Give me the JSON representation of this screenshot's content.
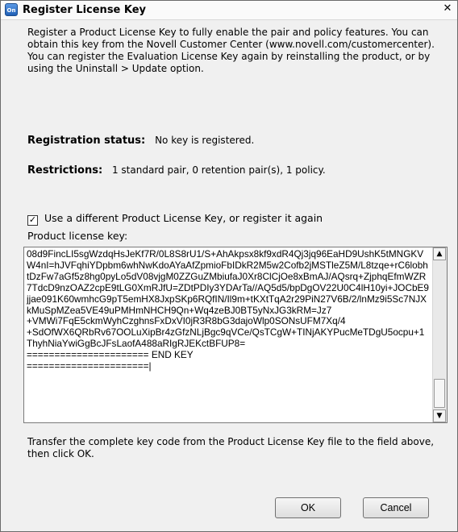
{
  "window": {
    "title": "Register License Key",
    "app_icon": "novell-icon",
    "close_glyph": "✕"
  },
  "intro_text": "Register a Product License Key to fully enable the pair and policy features. You can obtain this key from the Novell Customer Center (www.novell.com/customercenter). You can register the Evaluation License Key again by reinstalling the product, or by using the Uninstall > Update option.",
  "registration": {
    "label": "Registration status:",
    "value": "No key is registered."
  },
  "restrictions": {
    "label": "Restrictions:",
    "value": "1 standard pair, 0 retention pair(s), 1 policy."
  },
  "checkbox": {
    "label": "Use a different Product License Key, or register it again",
    "checked": true
  },
  "key_field": {
    "label": "Product license key:",
    "value": "08d9FincLI5sgWzdqHsJeKf7R/0L8S8rU1/S+AhAkpsx8kf9xdR4Qj3jq96EaHD9UshK5tMNGKVW4nI=hJVFqhiYDpbm6whNwKdoAYaAfZpmioFbIDkR2M5w2Cofb2jMSTleZ5M/L8tzqe+rC6lobhtDzFw7aGf5z8hg0pyLo5dV08vjgM0ZZGuZMbiufaJ0Xr8ClCjOe8xBmAJ/AQsrq+ZjphqEfmWZR7TdcD9nzOAZ2cpE9tLG0XmRJfU=ZDtPDIy3YDArTa//AQ5d5/bpDgOV22U0C4lH10yi+JOCbE9jjae091K60wmhcG9pT5emHX8JxpSKp6RQfIN/Il9m+tKXtTqA2r29PiN27V6B/2/lnMz9i5Sc7NJXkMuSpMZea5VE49uPMHmNHCH9Qn+Wq4zeBJ0BT5yNxJG3kRM=Jz7\n+VMWi7FqE5ckmWyhCzghnsFxDxVI0jR3R8bG3dajoWlp0SONsUFM7Xq/4\n+SdOfWX6QRbRv67OOLuXipBr4zGfzNLjBgc9qVCe/QsTCgW+TINjAKYPucMeTDgU5ocpu+1ThyhNiaYwiGgBcJFsLaofA488aRIgRJEKctBFUP8=\n====================== END KEY\n======================|"
  },
  "footer_note": "Transfer the complete key code from the Product License Key file to the field above, then click OK.",
  "buttons": {
    "ok": "OK",
    "cancel": "Cancel"
  }
}
